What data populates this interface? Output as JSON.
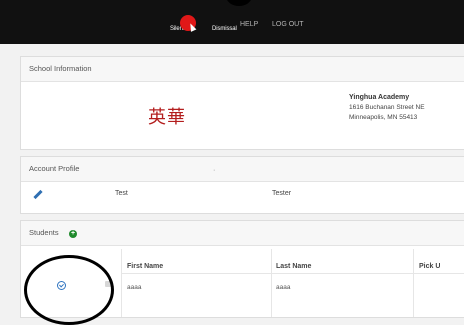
{
  "app": {
    "brand_silent": "Silent",
    "brand_dismissal": "Dismissal",
    "help": "HELP",
    "logout": "LOG OUT"
  },
  "school": {
    "header": "School Information",
    "logo": "英華",
    "name": "Yinghua Academy",
    "address1": "1616 Buchanan Street NE",
    "address2": "Minneapolis, MN 55413"
  },
  "profile": {
    "header": "Account Profile",
    "first_name": "Test",
    "last_name": "Tester",
    "separator": "·"
  },
  "students": {
    "header": "Students",
    "add_icon": "plus-circle-icon",
    "columns": {
      "first": "First Name",
      "last": "Last Name",
      "pickup": "Pick U"
    },
    "rows": [
      {
        "first": "aaaa",
        "last": "aaaa"
      }
    ]
  },
  "colors": {
    "topbar": "#111111",
    "logo": "#b31d1d",
    "accent": "#2f74c0",
    "add": "#1f8a2c"
  }
}
